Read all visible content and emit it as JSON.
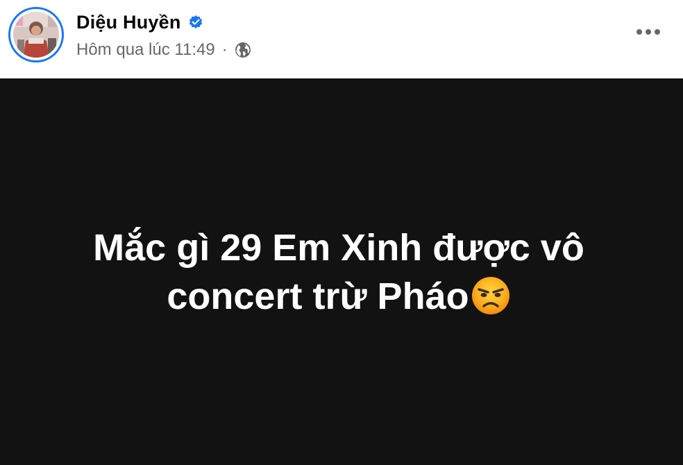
{
  "author": {
    "name": "Diệu Huyền",
    "verified": true
  },
  "meta": {
    "time": "Hôm qua lúc 11:49",
    "separator": "·",
    "audience_icon": "globe-icon"
  },
  "post": {
    "line1": "Mắc gì 29 Em Xinh được vô",
    "line2": "concert trừ Pháo",
    "emoji": "angry-face-icon",
    "background": "#121212",
    "text_color": "#ffffff"
  },
  "colors": {
    "accent": "#1877f2",
    "meta_text": "#65676b",
    "name_text": "#050505"
  }
}
